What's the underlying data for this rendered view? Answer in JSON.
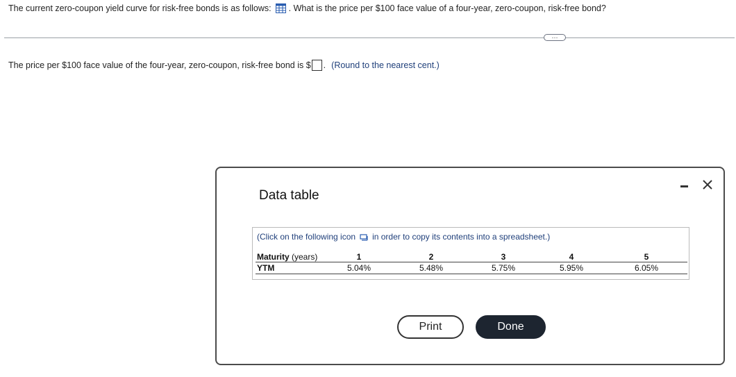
{
  "question": {
    "text_before": "The current zero-coupon yield curve for risk-free bonds is as follows:",
    "text_after": ". What is the price per $100 face value of a four-year, zero-coupon, risk-free bond?",
    "icon": "grid-table-icon"
  },
  "more_button": {
    "label": "···"
  },
  "answer": {
    "text_before": "The price per $100 face value of the four-year, zero-coupon, risk-free bond is $",
    "input_value": "",
    "text_after": ".",
    "hint": "(Round to the nearest cent.)"
  },
  "modal": {
    "title": "Data table",
    "copy_note_before": "(Click on the following icon",
    "copy_note_after": "in order to copy its contents into a spreadsheet.)",
    "row1_label": "Maturity",
    "row1_unit": " (years)",
    "row2_label": "YTM",
    "maturities": [
      "1",
      "2",
      "3",
      "4",
      "5"
    ],
    "ytm": [
      "5.04%",
      "5.48%",
      "5.75%",
      "5.95%",
      "6.05%"
    ],
    "print_label": "Print",
    "done_label": "Done"
  },
  "colors": {
    "hint_blue": "#1f3f7a",
    "done_bg": "#1d2530",
    "icon_blue": "#2a5db0"
  }
}
